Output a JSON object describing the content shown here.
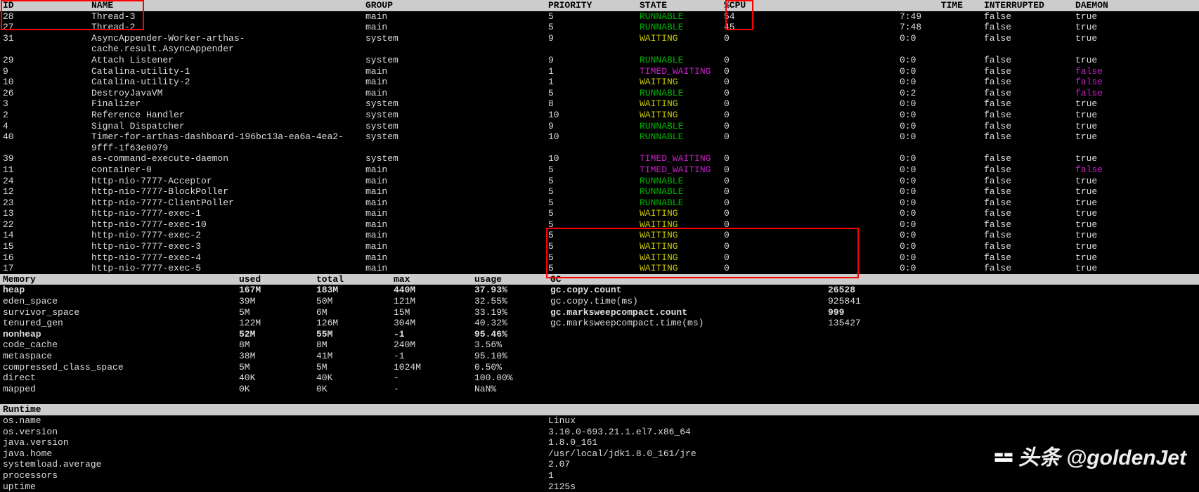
{
  "threads": {
    "headers": {
      "id": "ID",
      "name": "NAME",
      "group": "GROUP",
      "priority": "PRIORITY",
      "state": "STATE",
      "cpu": "%CPU",
      "time": "TIME",
      "interrupted": "INTERRUPTED",
      "daemon": "DAEMON"
    },
    "rows": [
      {
        "id": "28",
        "name": "Thread-3",
        "group": "main",
        "prio": "5",
        "state": "RUNNABLE",
        "cpu": "54",
        "time": "7:49",
        "intr": "false",
        "daemon": "true"
      },
      {
        "id": "27",
        "name": "Thread-2",
        "group": "main",
        "prio": "5",
        "state": "RUNNABLE",
        "cpu": "45",
        "time": "7:48",
        "intr": "false",
        "daemon": "true"
      },
      {
        "id": "31",
        "name": "AsyncAppender-Worker-arthas-cache.result.AsyncAppender",
        "group": "system",
        "prio": "9",
        "state": "WAITING",
        "cpu": "0",
        "time": "0:0",
        "intr": "false",
        "daemon": "true"
      },
      {
        "id": "29",
        "name": "Attach Listener",
        "group": "system",
        "prio": "9",
        "state": "RUNNABLE",
        "cpu": "0",
        "time": "0:0",
        "intr": "false",
        "daemon": "true"
      },
      {
        "id": "9",
        "name": "Catalina-utility-1",
        "group": "main",
        "prio": "1",
        "state": "TIMED_WAITING",
        "cpu": "0",
        "time": "0:0",
        "intr": "false",
        "daemon": "false"
      },
      {
        "id": "10",
        "name": "Catalina-utility-2",
        "group": "main",
        "prio": "1",
        "state": "WAITING",
        "cpu": "0",
        "time": "0:0",
        "intr": "false",
        "daemon": "false"
      },
      {
        "id": "26",
        "name": "DestroyJavaVM",
        "group": "main",
        "prio": "5",
        "state": "RUNNABLE",
        "cpu": "0",
        "time": "0:2",
        "intr": "false",
        "daemon": "false"
      },
      {
        "id": "3",
        "name": "Finalizer",
        "group": "system",
        "prio": "8",
        "state": "WAITING",
        "cpu": "0",
        "time": "0:0",
        "intr": "false",
        "daemon": "true"
      },
      {
        "id": "2",
        "name": "Reference Handler",
        "group": "system",
        "prio": "10",
        "state": "WAITING",
        "cpu": "0",
        "time": "0:0",
        "intr": "false",
        "daemon": "true"
      },
      {
        "id": "4",
        "name": "Signal Dispatcher",
        "group": "system",
        "prio": "9",
        "state": "RUNNABLE",
        "cpu": "0",
        "time": "0:0",
        "intr": "false",
        "daemon": "true"
      },
      {
        "id": "40",
        "name": "Timer-for-arthas-dashboard-196bc13a-ea6a-4ea2-9fff-1f63e0079",
        "group": "system",
        "prio": "10",
        "state": "RUNNABLE",
        "cpu": "0",
        "time": "0:0",
        "intr": "false",
        "daemon": "true"
      },
      {
        "id": "39",
        "name": "as-command-execute-daemon",
        "group": "system",
        "prio": "10",
        "state": "TIMED_WAITING",
        "cpu": "0",
        "time": "0:0",
        "intr": "false",
        "daemon": "true"
      },
      {
        "id": "11",
        "name": "container-0",
        "group": "main",
        "prio": "5",
        "state": "TIMED_WAITING",
        "cpu": "0",
        "time": "0:0",
        "intr": "false",
        "daemon": "false"
      },
      {
        "id": "24",
        "name": "http-nio-7777-Acceptor",
        "group": "main",
        "prio": "5",
        "state": "RUNNABLE",
        "cpu": "0",
        "time": "0:0",
        "intr": "false",
        "daemon": "true"
      },
      {
        "id": "12",
        "name": "http-nio-7777-BlockPoller",
        "group": "main",
        "prio": "5",
        "state": "RUNNABLE",
        "cpu": "0",
        "time": "0:0",
        "intr": "false",
        "daemon": "true"
      },
      {
        "id": "23",
        "name": "http-nio-7777-ClientPoller",
        "group": "main",
        "prio": "5",
        "state": "RUNNABLE",
        "cpu": "0",
        "time": "0:0",
        "intr": "false",
        "daemon": "true"
      },
      {
        "id": "13",
        "name": "http-nio-7777-exec-1",
        "group": "main",
        "prio": "5",
        "state": "WAITING",
        "cpu": "0",
        "time": "0:0",
        "intr": "false",
        "daemon": "true"
      },
      {
        "id": "22",
        "name": "http-nio-7777-exec-10",
        "group": "main",
        "prio": "5",
        "state": "WAITING",
        "cpu": "0",
        "time": "0:0",
        "intr": "false",
        "daemon": "true"
      },
      {
        "id": "14",
        "name": "http-nio-7777-exec-2",
        "group": "main",
        "prio": "5",
        "state": "WAITING",
        "cpu": "0",
        "time": "0:0",
        "intr": "false",
        "daemon": "true"
      },
      {
        "id": "15",
        "name": "http-nio-7777-exec-3",
        "group": "main",
        "prio": "5",
        "state": "WAITING",
        "cpu": "0",
        "time": "0:0",
        "intr": "false",
        "daemon": "true"
      },
      {
        "id": "16",
        "name": "http-nio-7777-exec-4",
        "group": "main",
        "prio": "5",
        "state": "WAITING",
        "cpu": "0",
        "time": "0:0",
        "intr": "false",
        "daemon": "true"
      },
      {
        "id": "17",
        "name": "http-nio-7777-exec-5",
        "group": "main",
        "prio": "5",
        "state": "WAITING",
        "cpu": "0",
        "time": "0:0",
        "intr": "false",
        "daemon": "true"
      }
    ]
  },
  "memory": {
    "headers": {
      "label": "Memory",
      "used": "used",
      "total": "total",
      "max": "max",
      "usage": "usage"
    },
    "rows": [
      {
        "label": "heap",
        "used": "167M",
        "total": "183M",
        "max": "440M",
        "usage": "37.93%",
        "bold": true
      },
      {
        "label": "eden_space",
        "used": "39M",
        "total": "50M",
        "max": "121M",
        "usage": "32.55%"
      },
      {
        "label": "survivor_space",
        "used": "5M",
        "total": "6M",
        "max": "15M",
        "usage": "33.19%"
      },
      {
        "label": "tenured_gen",
        "used": "122M",
        "total": "126M",
        "max": "304M",
        "usage": "40.32%"
      },
      {
        "label": "nonheap",
        "used": "52M",
        "total": "55M",
        "max": "-1",
        "usage": "95.46%",
        "bold": true
      },
      {
        "label": "code_cache",
        "used": "8M",
        "total": "8M",
        "max": "240M",
        "usage": "3.56%"
      },
      {
        "label": "metaspace",
        "used": "38M",
        "total": "41M",
        "max": "-1",
        "usage": "95.10%"
      },
      {
        "label": "compressed_class_space",
        "used": "5M",
        "total": "5M",
        "max": "1024M",
        "usage": "0.50%"
      },
      {
        "label": "direct",
        "used": "40K",
        "total": "40K",
        "max": "-",
        "usage": "100.00%"
      },
      {
        "label": "mapped",
        "used": "0K",
        "total": "0K",
        "max": "-",
        "usage": "NaN%"
      }
    ]
  },
  "gc": {
    "header": "GC",
    "rows": [
      {
        "label": "gc.copy.count",
        "val": "26528",
        "bold": true
      },
      {
        "label": "gc.copy.time(ms)",
        "val": "925841"
      },
      {
        "label": "gc.marksweepcompact.count",
        "val": "999",
        "bold": true
      },
      {
        "label": "gc.marksweepcompact.time(ms)",
        "val": "135427"
      }
    ]
  },
  "runtime": {
    "header": "Runtime",
    "rows": [
      {
        "key": "os.name",
        "val": "Linux"
      },
      {
        "key": "os.version",
        "val": "3.10.0-693.21.1.el7.x86_64"
      },
      {
        "key": "java.version",
        "val": "1.8.0_161"
      },
      {
        "key": "java.home",
        "val": "/usr/local/jdk1.8.0_161/jre"
      },
      {
        "key": "systemload.average",
        "val": "2.07"
      },
      {
        "key": "processors",
        "val": "1"
      },
      {
        "key": "uptime",
        "val": "2125s"
      }
    ]
  },
  "watermark": "头条 @goldenJet"
}
